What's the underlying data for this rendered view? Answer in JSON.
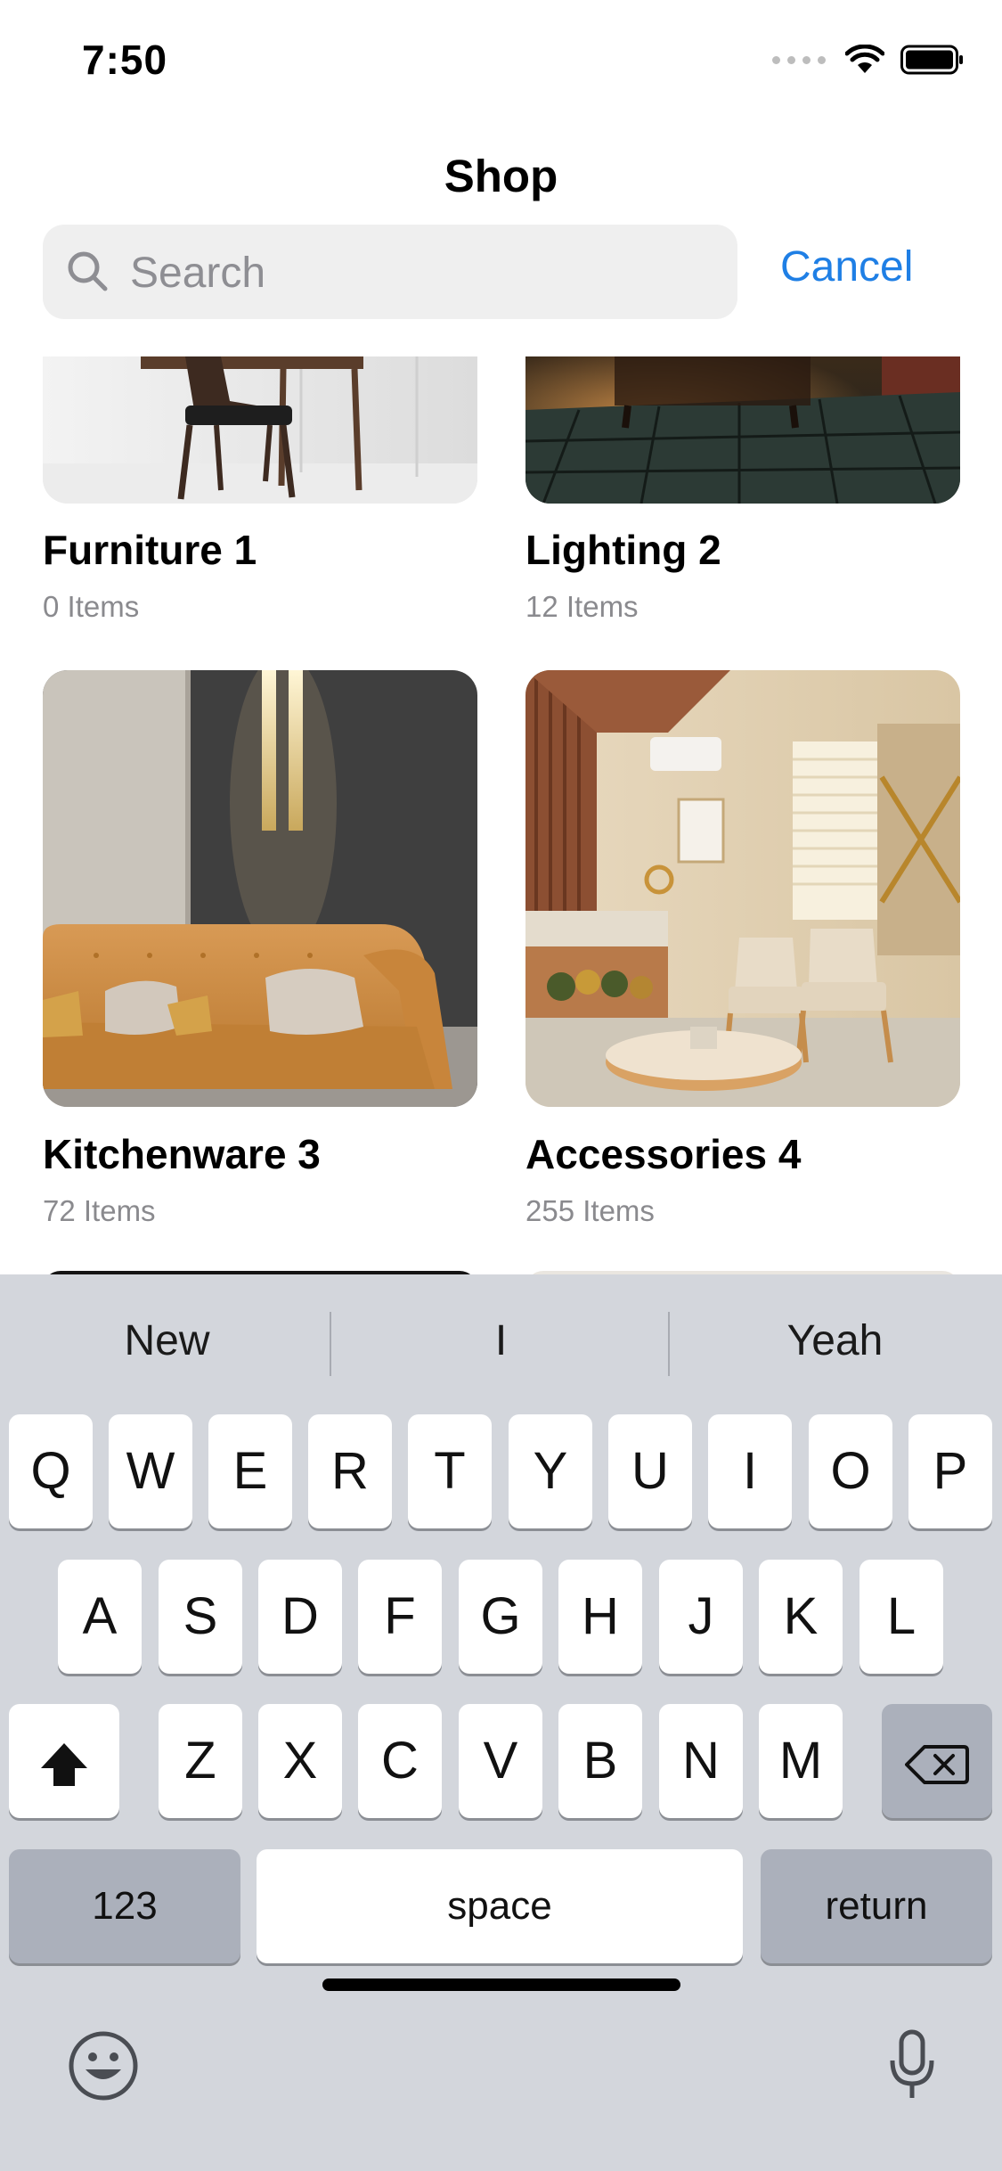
{
  "status_bar": {
    "time": "7:50"
  },
  "header": {
    "title": "Shop"
  },
  "search": {
    "placeholder": "Search",
    "cancel_label": "Cancel"
  },
  "collections": [
    {
      "title": "Furniture 1",
      "subtitle": "0 Items"
    },
    {
      "title": "Lighting 2",
      "subtitle": "12 Items"
    },
    {
      "title": "Kitchenware 3",
      "subtitle": "72 Items"
    },
    {
      "title": "Accessories 4",
      "subtitle": "255 Items"
    }
  ],
  "keyboard": {
    "suggestions": [
      "New",
      "I",
      "Yeah"
    ],
    "row1": [
      "Q",
      "W",
      "E",
      "R",
      "T",
      "Y",
      "U",
      "I",
      "O",
      "P"
    ],
    "row2": [
      "A",
      "S",
      "D",
      "F",
      "G",
      "H",
      "J",
      "K",
      "L"
    ],
    "row3": [
      "Z",
      "X",
      "C",
      "V",
      "B",
      "N",
      "M"
    ],
    "numbers_label": "123",
    "space_label": "space",
    "return_label": "return"
  },
  "colors": {
    "accent": "#1f7fe5",
    "keyboard_bg": "#d3d6dc",
    "search_bg": "#efefef"
  }
}
